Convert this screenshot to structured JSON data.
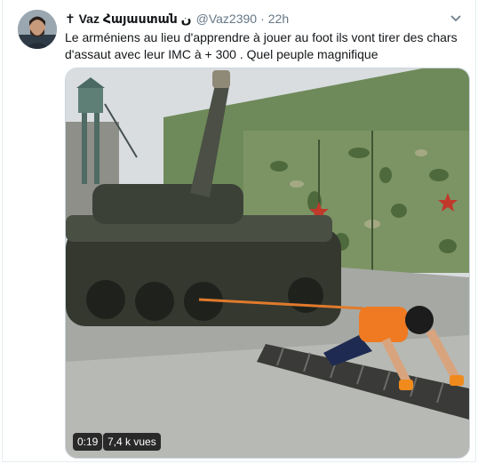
{
  "tweet": {
    "author_name": "✝ Vaz Հայաստան ن",
    "handle": "@Vaz2390",
    "separator": "·",
    "time": "22h",
    "text_line1": "Le arméniens au lieu d'apprendre à jouer au foot ils vont tirer des chars",
    "text_line2": "d'assaut avec leur IMC à + 300 . Quel peuple magnifique"
  },
  "media": {
    "duration": "0:19",
    "views": "7,4 k vues"
  },
  "icons": {
    "menu": "chevron-down-icon",
    "avatar": "avatar"
  },
  "colors": {
    "text": "#14171a",
    "secondary": "#657786",
    "border": "#e6ecf0"
  }
}
